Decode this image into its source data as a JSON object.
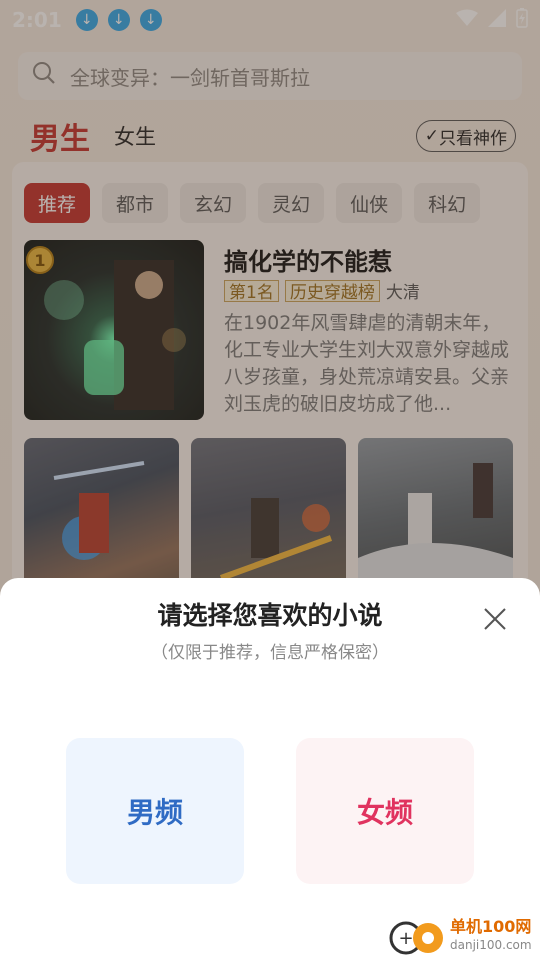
{
  "status": {
    "time": "2:01"
  },
  "search": {
    "placeholder": "全球变异：一剑斩首哥斯拉"
  },
  "gender_tabs": {
    "male": "男生",
    "female": "女生",
    "filter": "只看神作"
  },
  "categories": [
    "推荐",
    "都市",
    "玄幻",
    "灵幻",
    "仙侠",
    "科幻"
  ],
  "book": {
    "rank_badge": "1",
    "title": "搞化学的不能惹",
    "rank_label": "第1名",
    "list_label": "历史穿越榜",
    "tag": "大清",
    "desc": "在1902年风雪肆虐的清朝末年，化工专业大学生刘大双意外穿越成八岁孩童，身处荒凉靖安县。父亲刘玉虎的破旧皮坊成了他..."
  },
  "sheet": {
    "title": "请选择您喜欢的小说",
    "subtitle": "（仅限于推荐，信息严格保密）",
    "male_choice": "男频",
    "female_choice": "女频"
  },
  "watermark": {
    "cn": "单机100网",
    "en": "danji100.com"
  },
  "colors": {
    "accent": "#c2302b",
    "male": "#2f6bc4",
    "female": "#e0335f"
  }
}
